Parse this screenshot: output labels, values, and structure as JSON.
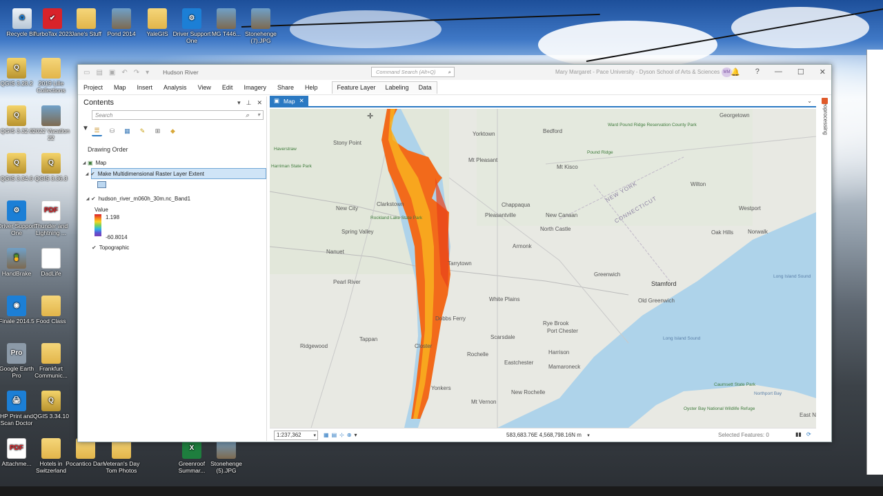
{
  "desktop": {
    "icons": [
      {
        "label": "Recycle Bin",
        "type": "recycle",
        "glyph": "♻"
      },
      {
        "label": "TurboTax 2023",
        "type": "red",
        "glyph": "✔"
      },
      {
        "label": "Jane's Stuff",
        "type": "folder",
        "glyph": ""
      },
      {
        "label": "Pond 2014",
        "type": "photo",
        "glyph": ""
      },
      {
        "label": "YaleGIS",
        "type": "folder",
        "glyph": ""
      },
      {
        "label": "Driver Support One",
        "type": "blue",
        "glyph": "⚙"
      },
      {
        "label": "MG T446...",
        "type": "photo",
        "glyph": ""
      },
      {
        "label": "Stonehenge (7).JPG",
        "type": "photo",
        "glyph": ""
      },
      {
        "label": "QGIS 3.28.2",
        "type": "qgis",
        "glyph": "Q"
      },
      {
        "label": "2019 Lille Collections",
        "type": "folder",
        "glyph": ""
      },
      {
        "label": "QGIS 3.32.0",
        "type": "qgis",
        "glyph": "Q"
      },
      {
        "label": "2022 Vacation 22",
        "type": "photo",
        "glyph": ""
      },
      {
        "label": "QGIS 3.34.6",
        "type": "qgis",
        "glyph": "Q"
      },
      {
        "label": "QGIS 3.36.3",
        "type": "qgis",
        "glyph": "Q"
      },
      {
        "label": "Driver Support One",
        "type": "blue",
        "glyph": "⚙"
      },
      {
        "label": "Thunder and Lightning ...",
        "type": "pdf",
        "glyph": "PDF"
      },
      {
        "label": "HandBrake",
        "type": "photo",
        "glyph": "🍍"
      },
      {
        "label": "DadLife",
        "type": "pdf",
        "glyph": ""
      },
      {
        "label": "Finale 2014.5",
        "type": "blue",
        "glyph": "◉"
      },
      {
        "label": "Food Class",
        "type": "folder",
        "glyph": ""
      },
      {
        "label": "Google Earth Pro",
        "type": "gray",
        "glyph": "Pro"
      },
      {
        "label": "Frankfurt Communic...",
        "type": "folder",
        "glyph": ""
      },
      {
        "label": "HP Print and Scan Doctor",
        "type": "blue",
        "glyph": "🖨"
      },
      {
        "label": "QGIS 3.34.10",
        "type": "qgis",
        "glyph": "Q"
      },
      {
        "label": "Attachme...",
        "type": "pdf",
        "glyph": "PDF"
      },
      {
        "label": "Hotels in Switzerland",
        "type": "folder",
        "glyph": ""
      },
      {
        "label": "Pocantico Dam",
        "type": "folder",
        "glyph": ""
      },
      {
        "label": "Veteran's Day Tom Photos",
        "type": "folder",
        "glyph": ""
      },
      {
        "label": "Greenroof Summar...",
        "type": "green",
        "glyph": "X"
      },
      {
        "label": "Stonehenge (5).JPG",
        "type": "photo",
        "glyph": ""
      }
    ]
  },
  "app": {
    "project_name": "Hudson River",
    "command_search_placeholder": "Command Search (Alt+Q)",
    "user": "Mary Margaret - Pace University - Dyson School of Arts & Sciences",
    "user_initials": "MM",
    "menu": [
      "Project",
      "Map",
      "Insert",
      "Analysis",
      "View",
      "Edit",
      "Imagery",
      "Share",
      "Help"
    ],
    "context_menu": [
      "Feature Layer",
      "Labeling",
      "Data"
    ],
    "contents": {
      "title": "Contents",
      "search_placeholder": "Search",
      "drawing_order": "Drawing Order",
      "map_name": "Map",
      "layers": [
        {
          "name": "Make Multidimensional Raster Layer Extent",
          "checked": true,
          "selected": true
        },
        {
          "name": "hudson_river_m060h_30m.nc_Band1",
          "checked": true,
          "selected": false
        },
        {
          "name": "Topographic",
          "checked": true,
          "selected": false
        }
      ],
      "legend": {
        "title": "Value",
        "high": "1.198",
        "low": "-60.8014"
      }
    },
    "map_tab": "Map",
    "geoprocessing": "Geoprocessing",
    "status": {
      "scale": "1:237,362",
      "coordinates": "583,683.76E 4,568,798.16N m",
      "selected_features": "Selected Features: 0"
    },
    "map_labels": [
      "Stony Point",
      "Haverstraw",
      "New City",
      "Clarkstown",
      "Spring Valley",
      "Nanuet",
      "Pearl River",
      "Tarrytown",
      "White Plains",
      "Scarsdale",
      "Yonkers",
      "Mt Vernon",
      "New Rochelle",
      "Eastchester",
      "Port Chester",
      "Harrison",
      "Rye Brook",
      "Mamaroneck",
      "Stamford",
      "Old Greenwich",
      "Greenwich",
      "Westport",
      "Norwalk",
      "Pound Ridge",
      "New Canaan",
      "North Castle",
      "Mt Kisco",
      "Bedford",
      "Georgetown",
      "Chappaqua",
      "Pleasantville",
      "Armonk",
      "NEW YORK",
      "CONNECTICUT",
      "Long Island Sound",
      "Northport Bay",
      "Long Island Sound",
      "Ridgewood",
      "Tappan",
      "Closter",
      "Dobbs Ferry",
      "Ward Pound Ridge Reservation County Park",
      "Harriman State Park",
      "Rockland Lake State Park",
      "Oyster Bay National Wildlife Refuge",
      "East Norwalk",
      "Caumsett State Park",
      "Wilton",
      "Rochelle",
      "Mt Pleasant",
      "Yorktown",
      "Oak Hills"
    ],
    "accent": "#2b79c2",
    "raster_colors": [
      "#f9d423",
      "#f57b1c",
      "#f05a1a"
    ]
  }
}
